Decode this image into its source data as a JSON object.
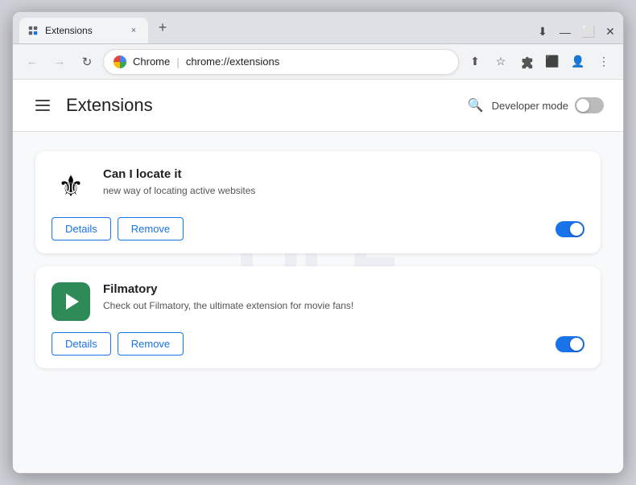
{
  "window": {
    "title": "Extensions",
    "tab_close": "×",
    "new_tab": "+",
    "controls": {
      "minimize": "—",
      "maximize": "⬜",
      "close": "✕",
      "restore": "⬇"
    }
  },
  "nav": {
    "back": "←",
    "forward": "→",
    "refresh": "↻",
    "chrome_label": "Chrome",
    "address": "chrome://extensions",
    "separator": "|",
    "share_icon": "⬆",
    "star_icon": "☆",
    "extensions_icon": "🧩",
    "split_icon": "⬛",
    "profile_icon": "👤",
    "menu_icon": "⋮"
  },
  "extensions_page": {
    "header": {
      "menu_icon": "≡",
      "title": "Extensions",
      "search_icon": "🔍",
      "developer_mode_label": "Developer mode"
    },
    "extensions": [
      {
        "id": "can-i-locate-it",
        "name": "Can I locate it",
        "description": "new way of locating active websites",
        "details_label": "Details",
        "remove_label": "Remove",
        "enabled": true
      },
      {
        "id": "filmatory",
        "name": "Filmatory",
        "description": "Check out Filmatory, the ultimate extension for movie fans!",
        "details_label": "Details",
        "remove_label": "Remove",
        "enabled": true
      }
    ]
  }
}
